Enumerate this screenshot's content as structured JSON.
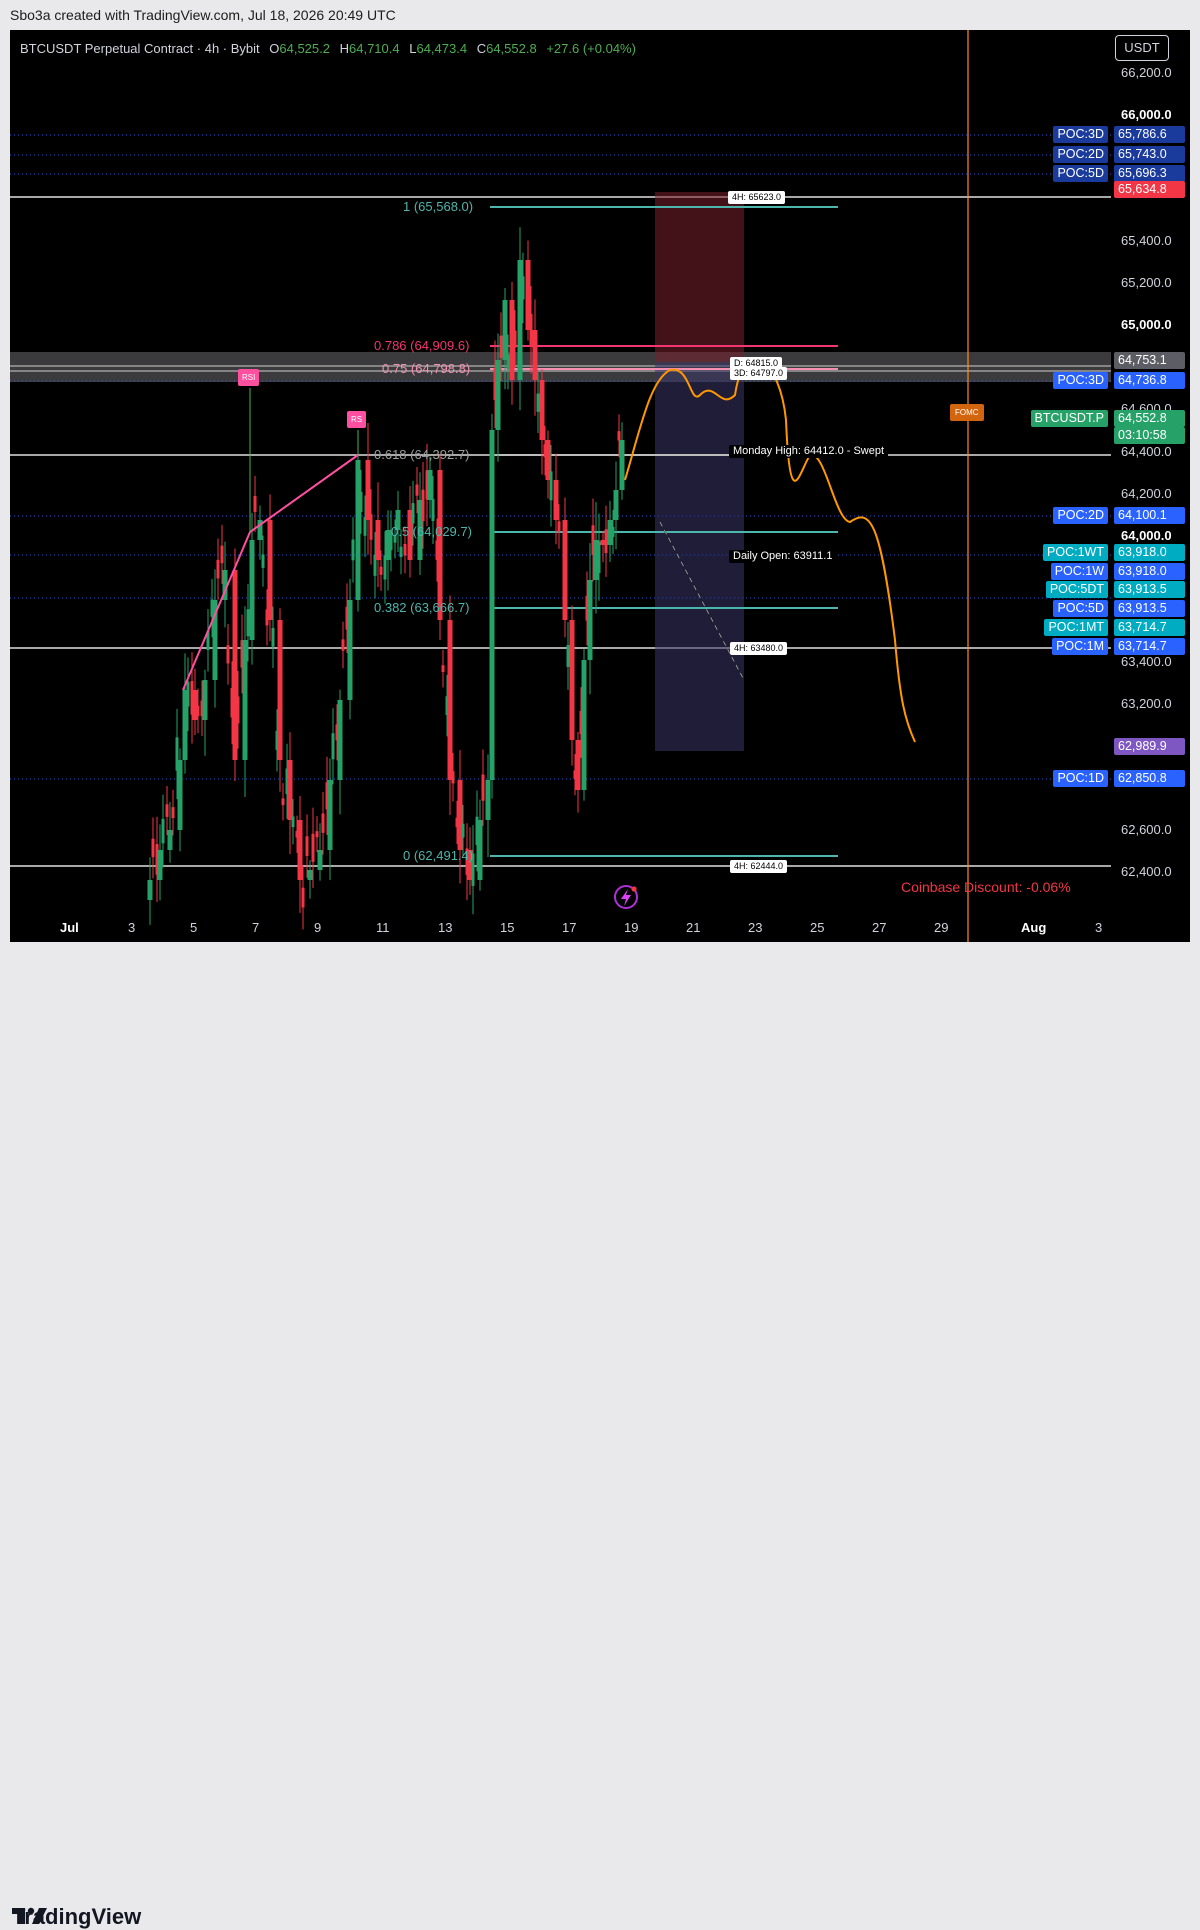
{
  "credit": "Sbo3a created with TradingView.com, Jul 18, 2026 20:49 UTC",
  "legend": {
    "symbol": "BTCUSDT Perpetual Contract · 4h · Bybit",
    "o_label": "O",
    "o": "64,525.2",
    "h_label": "H",
    "h": "64,710.4",
    "l_label": "L",
    "l": "64,473.4",
    "c_label": "C",
    "c": "64,552.8",
    "change": "+27.6 (+0.04%)"
  },
  "currency": "USDT",
  "y_ticks": [
    {
      "label": "66,200.0",
      "bold": false
    },
    {
      "label": "66,000.0",
      "bold": true
    },
    {
      "label": "65,400.0",
      "bold": false
    },
    {
      "label": "65,200.0",
      "bold": false
    },
    {
      "label": "65,000.0",
      "bold": true
    },
    {
      "label": "64,600.0",
      "bold": false
    },
    {
      "label": "64,400.0",
      "bold": false
    },
    {
      "label": "64,200.0",
      "bold": false
    },
    {
      "label": "64,000.0",
      "bold": true
    },
    {
      "label": "63,400.0",
      "bold": false
    },
    {
      "label": "63,200.0",
      "bold": false
    },
    {
      "label": "62,600.0",
      "bold": false
    },
    {
      "label": "62,400.0",
      "bold": false
    }
  ],
  "price_tags": [
    {
      "name": "POC:3D",
      "value": "65,786.6",
      "color": "#1a3a9c"
    },
    {
      "name": "POC:2D",
      "value": "65,743.0",
      "color": "#1a3a9c"
    },
    {
      "name": "POC:5D",
      "value": "65,696.3",
      "color": "#1a3a9c"
    },
    {
      "name": "",
      "value": "65,634.8",
      "color": "#f23645"
    },
    {
      "name": "",
      "value": "64,753.1",
      "color": "#5d5d66"
    },
    {
      "name": "POC:3D",
      "value": "64,736.8",
      "color": "#2962ff"
    },
    {
      "name": "BTCUSDT.P",
      "value": "64,552.8",
      "color": "#26a269"
    },
    {
      "name": "POC:2D",
      "value": "64,100.1",
      "color": "#2962ff"
    },
    {
      "name": "POC:1WT",
      "value": "63,918.0",
      "color": "#00acc1"
    },
    {
      "name": "POC:1W",
      "value": "63,918.0",
      "color": "#2962ff"
    },
    {
      "name": "POC:5DT",
      "value": "63,913.5",
      "color": "#00acc1"
    },
    {
      "name": "POC:5D",
      "value": "63,913.5",
      "color": "#2962ff"
    },
    {
      "name": "POC:1MT",
      "value": "63,714.7",
      "color": "#00acc1"
    },
    {
      "name": "POC:1M",
      "value": "63,714.7",
      "color": "#2962ff"
    },
    {
      "name": "",
      "value": "62,989.9",
      "color": "#7e57c2"
    },
    {
      "name": "POC:1D",
      "value": "62,850.8",
      "color": "#2962ff"
    }
  ],
  "countdown": "03:10:58",
  "fib_levels": [
    {
      "label": "1 (65,568.0)",
      "color": "#4db6ac"
    },
    {
      "label": "0.786 (64,909.6)",
      "color": "#f23670"
    },
    {
      "label": "0.75 (64,798.8)",
      "color": "#f48fb1"
    },
    {
      "label": "0.618 (64,392.7)",
      "color": "#9e9e9e"
    },
    {
      "label": "0.5 (64,029.7)",
      "color": "#4db6ac"
    },
    {
      "label": "0.382 (63,666.7)",
      "color": "#4db6ac"
    },
    {
      "label": "0 (62,491.4)",
      "color": "#4db6ac"
    }
  ],
  "annotations": {
    "h4_high": "4H: 65623.0",
    "d_level": "D: 64815.0",
    "d3_level": "3D: 64797.0",
    "monday_high": "Monday High: 64412.0 - Swept",
    "daily_open": "Daily Open: 63911.1",
    "h4_mid": "4H: 63480.0",
    "h4_low": "4H: 62444.0",
    "fomc": "FOMC",
    "rsi1": "RSI",
    "rsi2": "RS",
    "coinbase": "Coinbase Discount: -0.06%"
  },
  "x_ticks": [
    "Jul",
    "3",
    "5",
    "7",
    "9",
    "11",
    "13",
    "15",
    "17",
    "19",
    "21",
    "23",
    "25",
    "27",
    "29",
    "Aug",
    "3"
  ],
  "brand": "TradingView",
  "colors": {
    "up": "#26a269",
    "down": "#f23645",
    "projection": "#ff9800"
  }
}
